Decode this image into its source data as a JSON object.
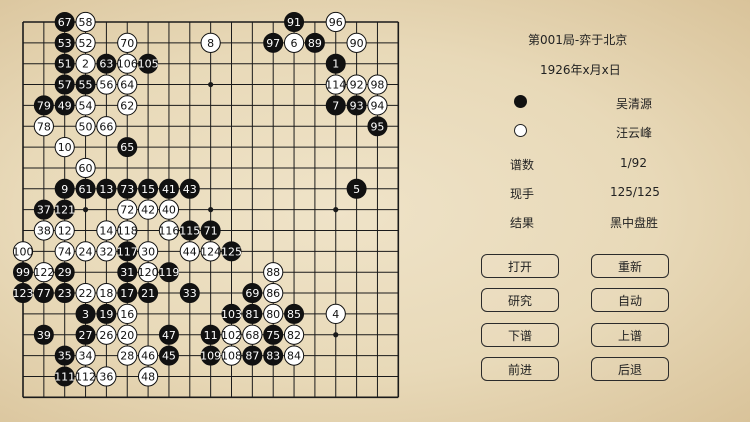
{
  "game": {
    "title": "第001局-弈于北京",
    "date": "1926年x月x日",
    "black_player": "吴清源",
    "white_player": "汪云峰",
    "labels": {
      "moves": "谱数",
      "current": "现手",
      "result": "结果"
    },
    "moves_value": "1/92",
    "current_value": "125/125",
    "result_value": "黑中盘胜"
  },
  "buttons": {
    "open": "打开",
    "reset": "重新",
    "study": "研究",
    "auto": "自动",
    "next_record": "下谱",
    "prev_record": "上谱",
    "forward": "前进",
    "back": "后退"
  },
  "colors": {
    "black": "#111111",
    "white": "#ffffff",
    "line": "#1a1a1a"
  },
  "board": {
    "size": 19,
    "stones": [
      {
        "c": "B",
        "x": 3,
        "y": 1,
        "n": "67"
      },
      {
        "c": "W",
        "x": 4,
        "y": 1,
        "n": "58"
      },
      {
        "c": "B",
        "x": 14,
        "y": 1,
        "n": "91"
      },
      {
        "c": "W",
        "x": 16,
        "y": 1,
        "n": "96"
      },
      {
        "c": "B",
        "x": 3,
        "y": 2,
        "n": "53"
      },
      {
        "c": "W",
        "x": 4,
        "y": 2,
        "n": "52"
      },
      {
        "c": "W",
        "x": 6,
        "y": 2,
        "n": "70"
      },
      {
        "c": "W",
        "x": 10,
        "y": 2,
        "n": "8"
      },
      {
        "c": "B",
        "x": 13,
        "y": 2,
        "n": "97"
      },
      {
        "c": "W",
        "x": 14,
        "y": 2,
        "n": "6"
      },
      {
        "c": "B",
        "x": 15,
        "y": 2,
        "n": "89"
      },
      {
        "c": "W",
        "x": 17,
        "y": 2,
        "n": "90"
      },
      {
        "c": "B",
        "x": 3,
        "y": 3,
        "n": "51"
      },
      {
        "c": "W",
        "x": 4,
        "y": 3,
        "n": "2"
      },
      {
        "c": "B",
        "x": 5,
        "y": 3,
        "n": "63"
      },
      {
        "c": "W",
        "x": 6,
        "y": 3,
        "n": "106"
      },
      {
        "c": "B",
        "x": 7,
        "y": 3,
        "n": "105"
      },
      {
        "c": "B",
        "x": 16,
        "y": 3,
        "n": "1"
      },
      {
        "c": "B",
        "x": 3,
        "y": 4,
        "n": "57"
      },
      {
        "c": "B",
        "x": 4,
        "y": 4,
        "n": "55"
      },
      {
        "c": "W",
        "x": 5,
        "y": 4,
        "n": "56"
      },
      {
        "c": "W",
        "x": 6,
        "y": 4,
        "n": "64"
      },
      {
        "c": "W",
        "x": 16,
        "y": 4,
        "n": "114"
      },
      {
        "c": "W",
        "x": 17,
        "y": 4,
        "n": "92"
      },
      {
        "c": "W",
        "x": 18,
        "y": 4,
        "n": "98"
      },
      {
        "c": "B",
        "x": 2,
        "y": 5,
        "n": "79"
      },
      {
        "c": "B",
        "x": 3,
        "y": 5,
        "n": "49"
      },
      {
        "c": "W",
        "x": 4,
        "y": 5,
        "n": "54"
      },
      {
        "c": "W",
        "x": 6,
        "y": 5,
        "n": "62"
      },
      {
        "c": "B",
        "x": 16,
        "y": 5,
        "n": "7"
      },
      {
        "c": "B",
        "x": 17,
        "y": 5,
        "n": "93"
      },
      {
        "c": "W",
        "x": 18,
        "y": 5,
        "n": "94"
      },
      {
        "c": "W",
        "x": 2,
        "y": 6,
        "n": "78"
      },
      {
        "c": "W",
        "x": 4,
        "y": 6,
        "n": "50"
      },
      {
        "c": "W",
        "x": 5,
        "y": 6,
        "n": "66"
      },
      {
        "c": "B",
        "x": 18,
        "y": 6,
        "n": "95"
      },
      {
        "c": "W",
        "x": 3,
        "y": 7,
        "n": "10"
      },
      {
        "c": "B",
        "x": 6,
        "y": 7,
        "n": "65"
      },
      {
        "c": "W",
        "x": 4,
        "y": 8,
        "n": "60"
      },
      {
        "c": "B",
        "x": 3,
        "y": 9,
        "n": "9"
      },
      {
        "c": "B",
        "x": 4,
        "y": 9,
        "n": "61"
      },
      {
        "c": "B",
        "x": 5,
        "y": 9,
        "n": "13"
      },
      {
        "c": "B",
        "x": 6,
        "y": 9,
        "n": "73"
      },
      {
        "c": "B",
        "x": 7,
        "y": 9,
        "n": "15"
      },
      {
        "c": "B",
        "x": 8,
        "y": 9,
        "n": "41"
      },
      {
        "c": "B",
        "x": 9,
        "y": 9,
        "n": "43"
      },
      {
        "c": "B",
        "x": 17,
        "y": 9,
        "n": "5"
      },
      {
        "c": "B",
        "x": 2,
        "y": 10,
        "n": "37"
      },
      {
        "c": "B",
        "x": 3,
        "y": 10,
        "n": "121"
      },
      {
        "c": "W",
        "x": 6,
        "y": 10,
        "n": "72"
      },
      {
        "c": "W",
        "x": 7,
        "y": 10,
        "n": "42"
      },
      {
        "c": "W",
        "x": 8,
        "y": 10,
        "n": "40"
      },
      {
        "c": "W",
        "x": 2,
        "y": 11,
        "n": "38"
      },
      {
        "c": "W",
        "x": 3,
        "y": 11,
        "n": "12"
      },
      {
        "c": "W",
        "x": 5,
        "y": 11,
        "n": "14"
      },
      {
        "c": "W",
        "x": 6,
        "y": 11,
        "n": "118"
      },
      {
        "c": "W",
        "x": 8,
        "y": 11,
        "n": "116"
      },
      {
        "c": "B",
        "x": 9,
        "y": 11,
        "n": "115"
      },
      {
        "c": "B",
        "x": 10,
        "y": 11,
        "n": "71"
      },
      {
        "c": "W",
        "x": 1,
        "y": 12,
        "n": "100"
      },
      {
        "c": "W",
        "x": 3,
        "y": 12,
        "n": "74"
      },
      {
        "c": "W",
        "x": 4,
        "y": 12,
        "n": "24"
      },
      {
        "c": "W",
        "x": 5,
        "y": 12,
        "n": "32"
      },
      {
        "c": "B",
        "x": 6,
        "y": 12,
        "n": "117"
      },
      {
        "c": "W",
        "x": 7,
        "y": 12,
        "n": "30"
      },
      {
        "c": "W",
        "x": 9,
        "y": 12,
        "n": "44"
      },
      {
        "c": "W",
        "x": 10,
        "y": 12,
        "n": "124"
      },
      {
        "c": "B",
        "x": 11,
        "y": 12,
        "n": "125"
      },
      {
        "c": "B",
        "x": 1,
        "y": 13,
        "n": "99"
      },
      {
        "c": "W",
        "x": 2,
        "y": 13,
        "n": "122"
      },
      {
        "c": "B",
        "x": 3,
        "y": 13,
        "n": "29"
      },
      {
        "c": "B",
        "x": 6,
        "y": 13,
        "n": "31"
      },
      {
        "c": "W",
        "x": 7,
        "y": 13,
        "n": "120"
      },
      {
        "c": "B",
        "x": 8,
        "y": 13,
        "n": "119"
      },
      {
        "c": "W",
        "x": 13,
        "y": 13,
        "n": "88"
      },
      {
        "c": "B",
        "x": 1,
        "y": 14,
        "n": "123"
      },
      {
        "c": "B",
        "x": 2,
        "y": 14,
        "n": "77"
      },
      {
        "c": "B",
        "x": 3,
        "y": 14,
        "n": "23"
      },
      {
        "c": "W",
        "x": 4,
        "y": 14,
        "n": "22"
      },
      {
        "c": "W",
        "x": 5,
        "y": 14,
        "n": "18"
      },
      {
        "c": "B",
        "x": 6,
        "y": 14,
        "n": "17"
      },
      {
        "c": "B",
        "x": 7,
        "y": 14,
        "n": "21"
      },
      {
        "c": "B",
        "x": 9,
        "y": 14,
        "n": "33"
      },
      {
        "c": "B",
        "x": 12,
        "y": 14,
        "n": "69"
      },
      {
        "c": "W",
        "x": 13,
        "y": 14,
        "n": "86"
      },
      {
        "c": "B",
        "x": 4,
        "y": 15,
        "n": "3"
      },
      {
        "c": "B",
        "x": 5,
        "y": 15,
        "n": "19"
      },
      {
        "c": "W",
        "x": 6,
        "y": 15,
        "n": "16"
      },
      {
        "c": "B",
        "x": 11,
        "y": 15,
        "n": "103"
      },
      {
        "c": "B",
        "x": 12,
        "y": 15,
        "n": "81"
      },
      {
        "c": "W",
        "x": 13,
        "y": 15,
        "n": "80"
      },
      {
        "c": "B",
        "x": 14,
        "y": 15,
        "n": "85"
      },
      {
        "c": "W",
        "x": 16,
        "y": 15,
        "n": "4"
      },
      {
        "c": "B",
        "x": 2,
        "y": 16,
        "n": "39"
      },
      {
        "c": "B",
        "x": 4,
        "y": 16,
        "n": "27"
      },
      {
        "c": "W",
        "x": 5,
        "y": 16,
        "n": "26"
      },
      {
        "c": "W",
        "x": 6,
        "y": 16,
        "n": "20"
      },
      {
        "c": "B",
        "x": 8,
        "y": 16,
        "n": "47"
      },
      {
        "c": "B",
        "x": 10,
        "y": 16,
        "n": "11"
      },
      {
        "c": "W",
        "x": 11,
        "y": 16,
        "n": "102"
      },
      {
        "c": "W",
        "x": 12,
        "y": 16,
        "n": "68"
      },
      {
        "c": "B",
        "x": 13,
        "y": 16,
        "n": "75"
      },
      {
        "c": "W",
        "x": 14,
        "y": 16,
        "n": "82"
      },
      {
        "c": "B",
        "x": 3,
        "y": 17,
        "n": "35"
      },
      {
        "c": "W",
        "x": 4,
        "y": 17,
        "n": "34"
      },
      {
        "c": "W",
        "x": 6,
        "y": 17,
        "n": "28"
      },
      {
        "c": "W",
        "x": 7,
        "y": 17,
        "n": "46"
      },
      {
        "c": "B",
        "x": 8,
        "y": 17,
        "n": "45"
      },
      {
        "c": "B",
        "x": 10,
        "y": 17,
        "n": "109"
      },
      {
        "c": "W",
        "x": 11,
        "y": 17,
        "n": "108"
      },
      {
        "c": "B",
        "x": 12,
        "y": 17,
        "n": "87"
      },
      {
        "c": "B",
        "x": 13,
        "y": 17,
        "n": "83"
      },
      {
        "c": "W",
        "x": 14,
        "y": 17,
        "n": "84"
      },
      {
        "c": "B",
        "x": 3,
        "y": 18,
        "n": "111"
      },
      {
        "c": "W",
        "x": 4,
        "y": 18,
        "n": "112"
      },
      {
        "c": "W",
        "x": 5,
        "y": 18,
        "n": "36"
      },
      {
        "c": "W",
        "x": 7,
        "y": 18,
        "n": "48"
      }
    ]
  }
}
